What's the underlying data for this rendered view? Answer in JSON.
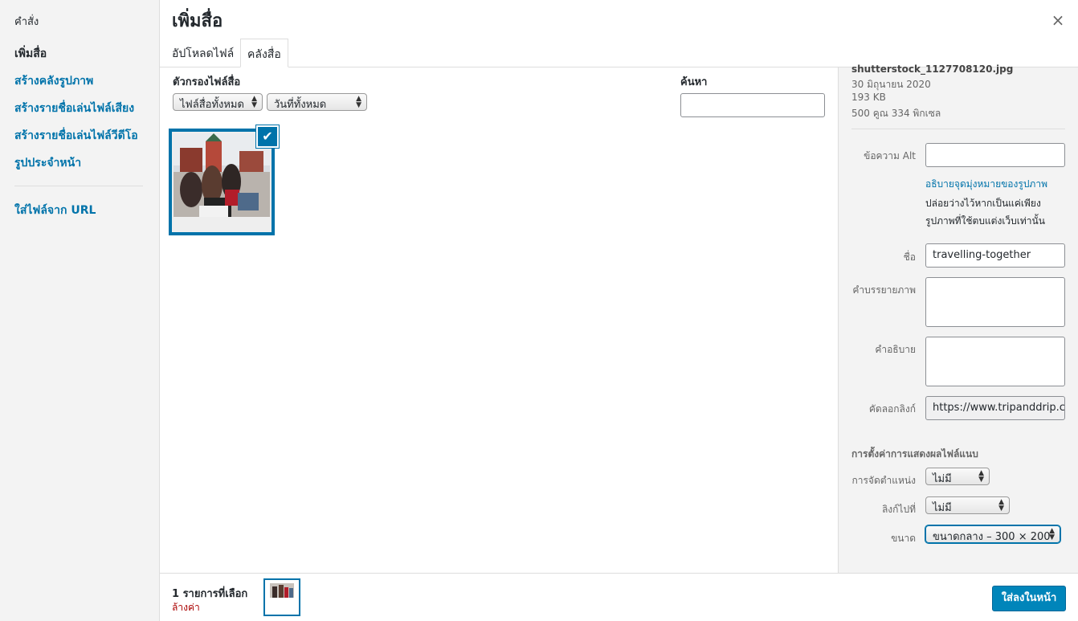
{
  "menu": {
    "heading": "คำสั่ง",
    "items": [
      {
        "label": "เพิ่มสื่อ"
      },
      {
        "label": "สร้างคลังรูปภาพ"
      },
      {
        "label": "สร้างรายชื่อเล่นไฟล์เสียง"
      },
      {
        "label": "สร้างรายชื่อเล่นไฟล์วีดีโอ"
      },
      {
        "label": "รูปประจำหน้า"
      },
      {
        "label": "ใส่ไฟล์จาก URL"
      }
    ]
  },
  "header": {
    "title": "เพิ่มสื่อ",
    "close_symbol": "×"
  },
  "tabs": [
    {
      "label": "อัปโหลดไฟล์"
    },
    {
      "label": "คลังสื่อ"
    }
  ],
  "filters": {
    "label": "ตัวกรองไฟล์สื่อ",
    "type_selected": "ไฟล์สื่อทั้งหมด",
    "date_selected": "วันที่ทั้งหมด",
    "search_label": "ค้นหา",
    "search_value": ""
  },
  "attachment": {
    "selected": true,
    "check_symbol": "✔",
    "filename": "shutterstock_1127708120.jpg",
    "date": "30 มิถุนายน 2020",
    "size": "193 KB",
    "dimensions": "500 คูณ 334 พิกเซล"
  },
  "details": {
    "alt_label": "ข้อความ Alt",
    "alt_value": "",
    "alt_help_link": "อธิบายจุดมุ่งหมายของรูปภาพ",
    "alt_help_text": "ปล่อยว่างไว้หากเป็นแค่เพียงรูปภาพที่ใช้ตบแต่งเว็บเท่านั้น",
    "title_label": "ชื่อ",
    "title_value": "travelling-together",
    "caption_label": "คำบรรยายภาพ",
    "caption_value": "",
    "description_label": "คำอธิบาย",
    "description_value": "",
    "copy_link_label": "คัดลอกลิงก์",
    "copy_link_value": "https://www.tripanddrip.c"
  },
  "display_settings": {
    "heading": "การตั้งค่าการแสดงผลไฟล์แนบ",
    "align_label": "การจัดตำแหน่ง",
    "align_value": "ไม่มี",
    "link_label": "ลิงก์ไปที่",
    "link_value": "ไม่มี",
    "size_label": "ขนาด",
    "size_value": "ขนาดกลาง – 300 × 200"
  },
  "toolbar": {
    "selection_count": "1 รายการที่เลือก",
    "clear_label": "ล้างค่า",
    "insert_label": "ใส่ลงในหน้า"
  },
  "colors": {
    "accent": "#0073aa",
    "primary_button": "#0085ba",
    "clear_link": "#aa0000"
  }
}
